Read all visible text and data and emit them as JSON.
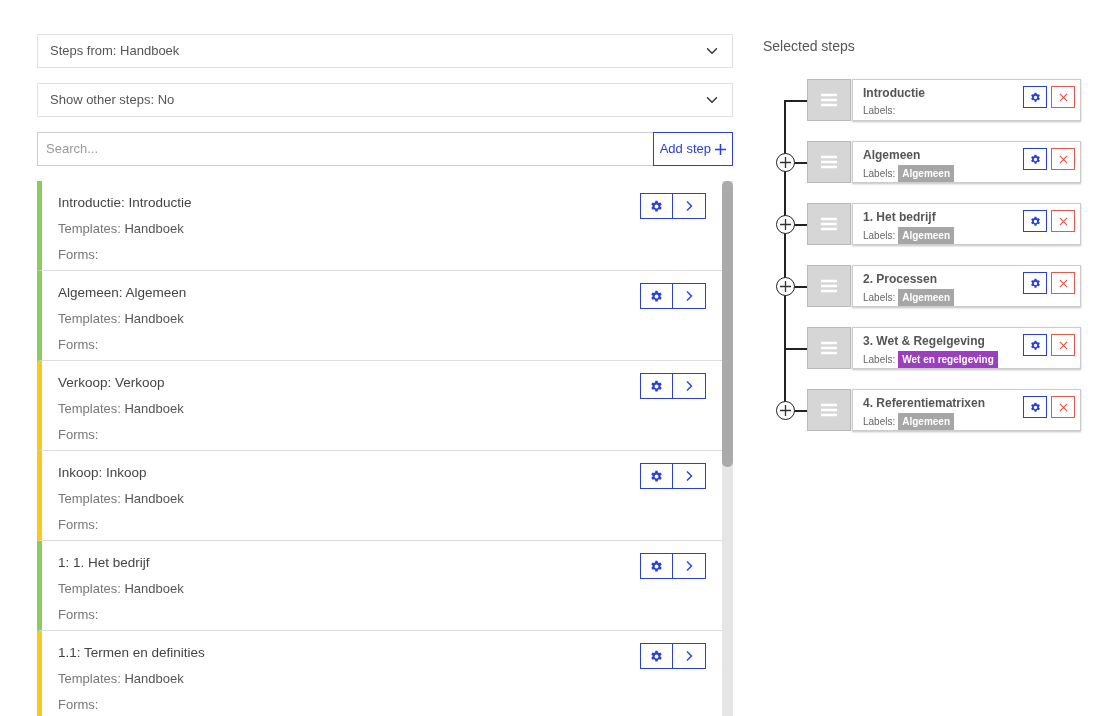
{
  "filters": [
    {
      "value": "Steps from: Handboek"
    },
    {
      "value": "Show other steps: No"
    }
  ],
  "search": {
    "placeholder": "Search...",
    "add_label": "Add step"
  },
  "steps": [
    {
      "title": "Introductie: Introductie",
      "templates_label": "Templates:",
      "templates": "Handboek",
      "forms_label": "Forms:",
      "color": "#8ccc5e"
    },
    {
      "title": "Algemeen: Algemeen",
      "templates_label": "Templates:",
      "templates": "Handboek",
      "forms_label": "Forms:",
      "color": "#8ccc5e"
    },
    {
      "title": "Verkoop: Verkoop",
      "templates_label": "Templates:",
      "templates": "Handboek",
      "forms_label": "Forms:",
      "color": "#f7cb1c"
    },
    {
      "title": "Inkoop: Inkoop",
      "templates_label": "Templates:",
      "templates": "Handboek",
      "forms_label": "Forms:",
      "color": "#f7cb1c"
    },
    {
      "title": "1: 1. Het bedrijf",
      "templates_label": "Templates:",
      "templates": "Handboek",
      "forms_label": "Forms:",
      "color": "#8ccc5e"
    },
    {
      "title": "1.1: Termen en definities",
      "templates_label": "Templates:",
      "templates": "Handboek",
      "forms_label": "Forms:",
      "color": "#f7cb1c"
    }
  ],
  "selected": {
    "title": "Selected steps",
    "items": [
      {
        "title": "Introductie",
        "labels_label": "Labels:",
        "insert_button": false
      },
      {
        "title": "Algemeen",
        "labels_label": "Labels:",
        "labels": [
          {
            "text": "Algemeen",
            "color": "#a6a6a6"
          }
        ],
        "insert_button": true
      },
      {
        "title": "1. Het bedrijf",
        "labels_label": "Labels:",
        "labels": [
          {
            "text": "Algemeen",
            "color": "#a6a6a6"
          }
        ],
        "insert_button": true
      },
      {
        "title": "2. Processen",
        "labels_label": "Labels:",
        "labels": [
          {
            "text": "Algemeen",
            "color": "#a6a6a6"
          }
        ],
        "insert_button": true
      },
      {
        "title": "3. Wet & Regelgeving",
        "labels_label": "Labels:",
        "labels": [
          {
            "text": "Wet en regelgeving",
            "color": "#9b3fbf"
          }
        ],
        "insert_button": false
      },
      {
        "title": "4. Referentiematrixen",
        "labels_label": "Labels:",
        "labels": [
          {
            "text": "Algemeen",
            "color": "#a6a6a6"
          }
        ],
        "insert_button": true
      }
    ]
  }
}
